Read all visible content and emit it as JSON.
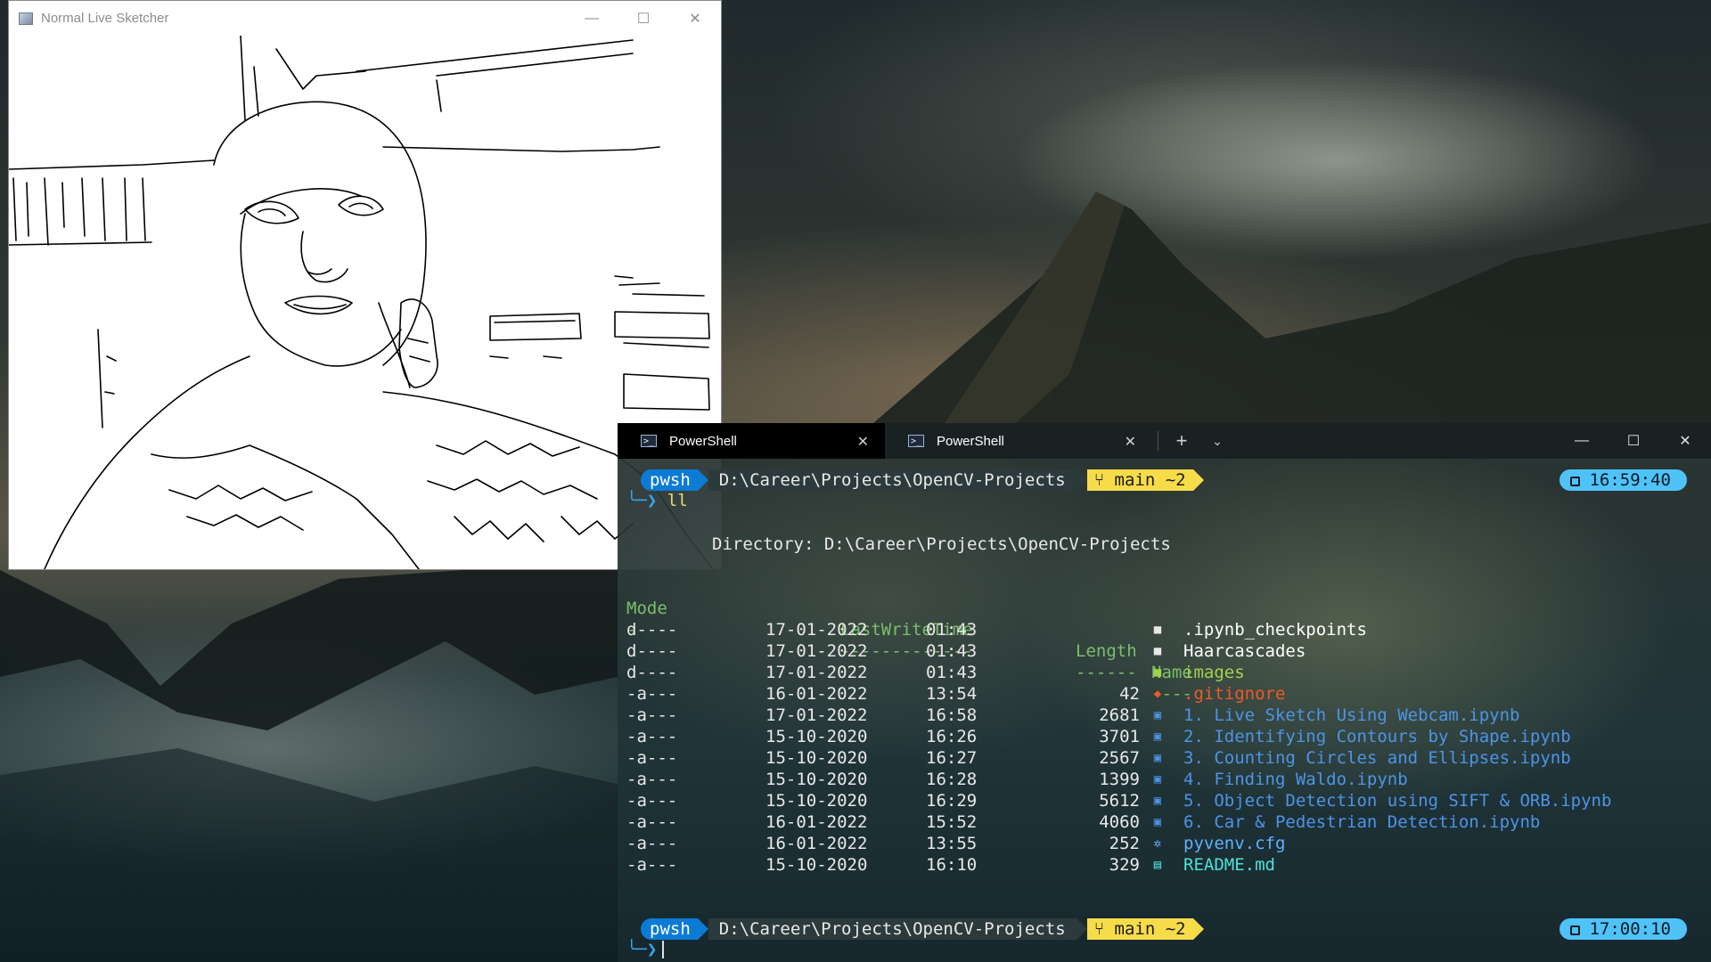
{
  "sketcher": {
    "title": "Normal Live Sketcher",
    "minimize": "—",
    "maximize": "☐",
    "close": "✕"
  },
  "terminal": {
    "tabs": [
      {
        "label": "PowerShell",
        "active": true
      },
      {
        "label": "PowerShell",
        "active": false
      }
    ],
    "new_tab": "+",
    "dropdown": "⌄",
    "window": {
      "minimize": "—",
      "maximize": "☐",
      "close": "✕"
    },
    "prompt1": {
      "shell": "pwsh",
      "path": "D:\\Career\\Projects\\OpenCV-Projects",
      "git": "main ~2",
      "time": "16:59:40"
    },
    "command": "ll",
    "directory_line": "Directory: D:\\Career\\Projects\\OpenCV-Projects",
    "headers": {
      "mode": "Mode",
      "lastwrite": "LastWriteTime",
      "length": "Length",
      "name": "Name",
      "mode_dash": "----",
      "lastwrite_dash": "-------------",
      "length_dash": "------",
      "name_dash": "----"
    },
    "rows": [
      {
        "mode": "d----",
        "date": "17-01-2022",
        "time": "01:43",
        "length": "",
        "icon": "folder-icon",
        "name": ".ipynb_checkpoints",
        "kind": "dir"
      },
      {
        "mode": "d----",
        "date": "17-01-2022",
        "time": "01:43",
        "length": "",
        "icon": "folder-icon",
        "name": "Haarcascades",
        "kind": "dir"
      },
      {
        "mode": "d----",
        "date": "17-01-2022",
        "time": "01:43",
        "length": "",
        "icon": "image-folder-icon",
        "name": "images",
        "kind": "img"
      },
      {
        "mode": "-a---",
        "date": "16-01-2022",
        "time": "13:54",
        "length": "42",
        "icon": "git-icon",
        "name": ".gitignore",
        "kind": "git"
      },
      {
        "mode": "-a---",
        "date": "17-01-2022",
        "time": "16:58",
        "length": "2681",
        "icon": "notebook-icon",
        "name": "1. Live Sketch Using Webcam.ipynb",
        "kind": "nb"
      },
      {
        "mode": "-a---",
        "date": "15-10-2020",
        "time": "16:26",
        "length": "3701",
        "icon": "notebook-icon",
        "name": "2. Identifying Contours by Shape.ipynb",
        "kind": "nb"
      },
      {
        "mode": "-a---",
        "date": "15-10-2020",
        "time": "16:27",
        "length": "2567",
        "icon": "notebook-icon",
        "name": "3. Counting Circles and Ellipses.ipynb",
        "kind": "nb"
      },
      {
        "mode": "-a---",
        "date": "15-10-2020",
        "time": "16:28",
        "length": "1399",
        "icon": "notebook-icon",
        "name": "4. Finding Waldo.ipynb",
        "kind": "nb"
      },
      {
        "mode": "-a---",
        "date": "15-10-2020",
        "time": "16:29",
        "length": "5612",
        "icon": "notebook-icon",
        "name": "5. Object Detection using SIFT & ORB.ipynb",
        "kind": "nb"
      },
      {
        "mode": "-a---",
        "date": "16-01-2022",
        "time": "15:52",
        "length": "4060",
        "icon": "notebook-icon",
        "name": "6. Car & Pedestrian Detection.ipynb",
        "kind": "nb"
      },
      {
        "mode": "-a---",
        "date": "16-01-2022",
        "time": "13:55",
        "length": "252",
        "icon": "gear-icon",
        "name": "pyvenv.cfg",
        "kind": "cfg"
      },
      {
        "mode": "-a---",
        "date": "15-10-2020",
        "time": "16:10",
        "length": "329",
        "icon": "book-icon",
        "name": "README.md",
        "kind": "md"
      }
    ],
    "prompt2": {
      "shell": "pwsh",
      "path": "D:\\Career\\Projects\\OpenCV-Projects",
      "git": "main ~2",
      "time": "17:00:10"
    }
  },
  "colors": {
    "prompt_blue": "#0c7bd6",
    "git_yellow": "#f7dc4a",
    "time_cyan": "#4fc3f7",
    "header_green": "#7bbf6a",
    "notebook_blue": "#4d94e6",
    "gitignore_orange": "#f05a26",
    "images_green": "#a6d04b",
    "readme_cyan": "#4fe0d8"
  }
}
